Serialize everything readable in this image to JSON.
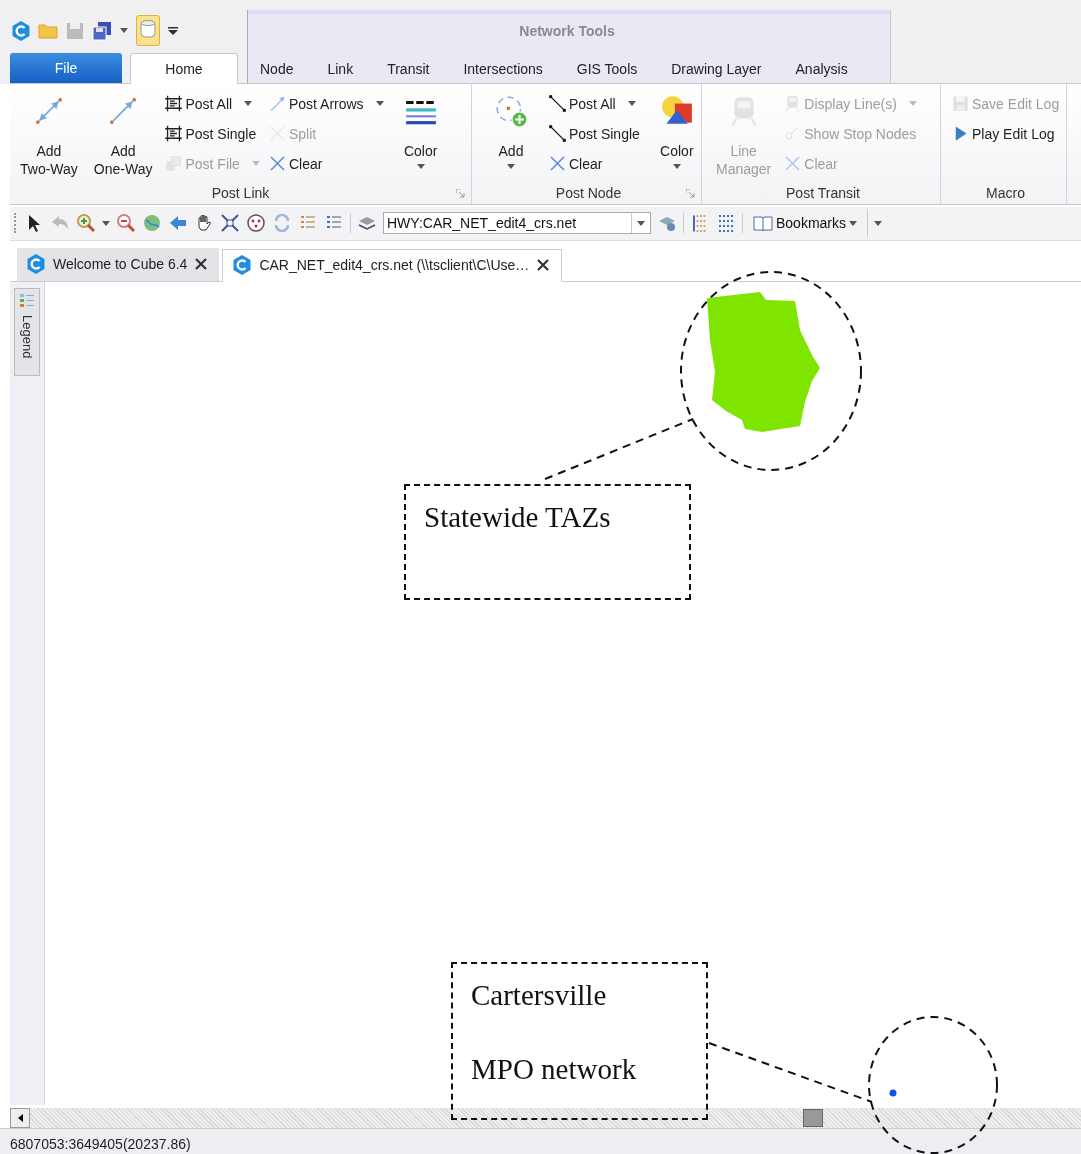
{
  "contextual_group": {
    "title": "Network Tools"
  },
  "ribbon_tabs": [
    {
      "label": "File",
      "kind": "file",
      "selected": false
    },
    {
      "label": "Home",
      "kind": "tab",
      "selected": true
    },
    {
      "label": "Node",
      "kind": "contextual",
      "selected": false
    },
    {
      "label": "Link",
      "kind": "contextual",
      "selected": false
    },
    {
      "label": "Transit",
      "kind": "contextual",
      "selected": false
    },
    {
      "label": "Intersections",
      "kind": "contextual",
      "selected": false
    },
    {
      "label": "GIS Tools",
      "kind": "contextual",
      "selected": false
    },
    {
      "label": "Drawing Layer",
      "kind": "contextual",
      "selected": false
    },
    {
      "label": "Analysis",
      "kind": "contextual",
      "selected": false
    }
  ],
  "ribbon_groups": [
    {
      "title": "Post Link",
      "launcher": true,
      "columns": [
        [
          {
            "label": "Add\nTwo-Way",
            "kind": "large",
            "disabled": false,
            "dropdown": false
          }
        ],
        [
          {
            "label": "Add\nOne-Way",
            "kind": "large",
            "disabled": false,
            "dropdown": false
          }
        ],
        [
          {
            "label": "Post All",
            "kind": "small",
            "disabled": false,
            "dropdown": true
          },
          {
            "label": "Post Single",
            "kind": "small",
            "disabled": false,
            "dropdown": false
          },
          {
            "label": "Post File",
            "kind": "small",
            "disabled": true,
            "dropdown": true
          }
        ],
        [
          {
            "label": "Post Arrows",
            "kind": "small",
            "disabled": false,
            "dropdown": true
          },
          {
            "label": "Split",
            "kind": "small",
            "disabled": true,
            "dropdown": false
          },
          {
            "label": "Clear",
            "kind": "small",
            "disabled": false,
            "dropdown": false
          }
        ],
        [
          {
            "label": "Color",
            "kind": "large",
            "disabled": false,
            "dropdown": true
          }
        ]
      ]
    },
    {
      "title": "Post Node",
      "launcher": true,
      "columns": [
        [
          {
            "label": "Add",
            "kind": "large",
            "disabled": false,
            "dropdown": true
          }
        ],
        [
          {
            "label": "Post All",
            "kind": "small",
            "disabled": false,
            "dropdown": true
          },
          {
            "label": "Post Single",
            "kind": "small",
            "disabled": false,
            "dropdown": false
          },
          {
            "label": "Clear",
            "kind": "small",
            "disabled": false,
            "dropdown": false
          }
        ],
        [
          {
            "label": "Color",
            "kind": "large",
            "disabled": false,
            "dropdown": true
          }
        ]
      ]
    },
    {
      "title": "Post Transit",
      "launcher": false,
      "columns": [
        [
          {
            "label": "Line\nManager",
            "kind": "large",
            "disabled": true,
            "dropdown": false
          }
        ],
        [
          {
            "label": "Display Line(s)",
            "kind": "small",
            "disabled": true,
            "dropdown": true
          },
          {
            "label": "Show Stop Nodes",
            "kind": "small",
            "disabled": true,
            "dropdown": false
          },
          {
            "label": "Clear",
            "kind": "small",
            "disabled": true,
            "dropdown": false
          }
        ]
      ]
    },
    {
      "title": "Macro",
      "launcher": false,
      "columns": [
        [
          {
            "label": "Save Edit Log",
            "kind": "small",
            "disabled": true,
            "dropdown": false
          },
          {
            "label": "Play Edit Log",
            "kind": "small",
            "disabled": false,
            "dropdown": false
          }
        ]
      ]
    }
  ],
  "toolbar": {
    "network_selector": "HWY:CAR_NET_edit4_crs.net",
    "bookmarks": "Bookmarks"
  },
  "document_tabs": [
    {
      "title": "Welcome to Cube 6.4",
      "selected": false
    },
    {
      "title": "CAR_NET_edit4_crs.net (\\\\tsclient\\C\\Use…",
      "selected": true
    }
  ],
  "legend_tab": {
    "label": "Legend"
  },
  "annotations": [
    {
      "kind": "callout",
      "lines": [
        "Statewide TAZs"
      ]
    },
    {
      "kind": "callout",
      "lines": [
        "Cartersville",
        "MPO network"
      ]
    }
  ],
  "status_bar": {
    "coordinates": "6807053:3649405(20237.86)"
  }
}
